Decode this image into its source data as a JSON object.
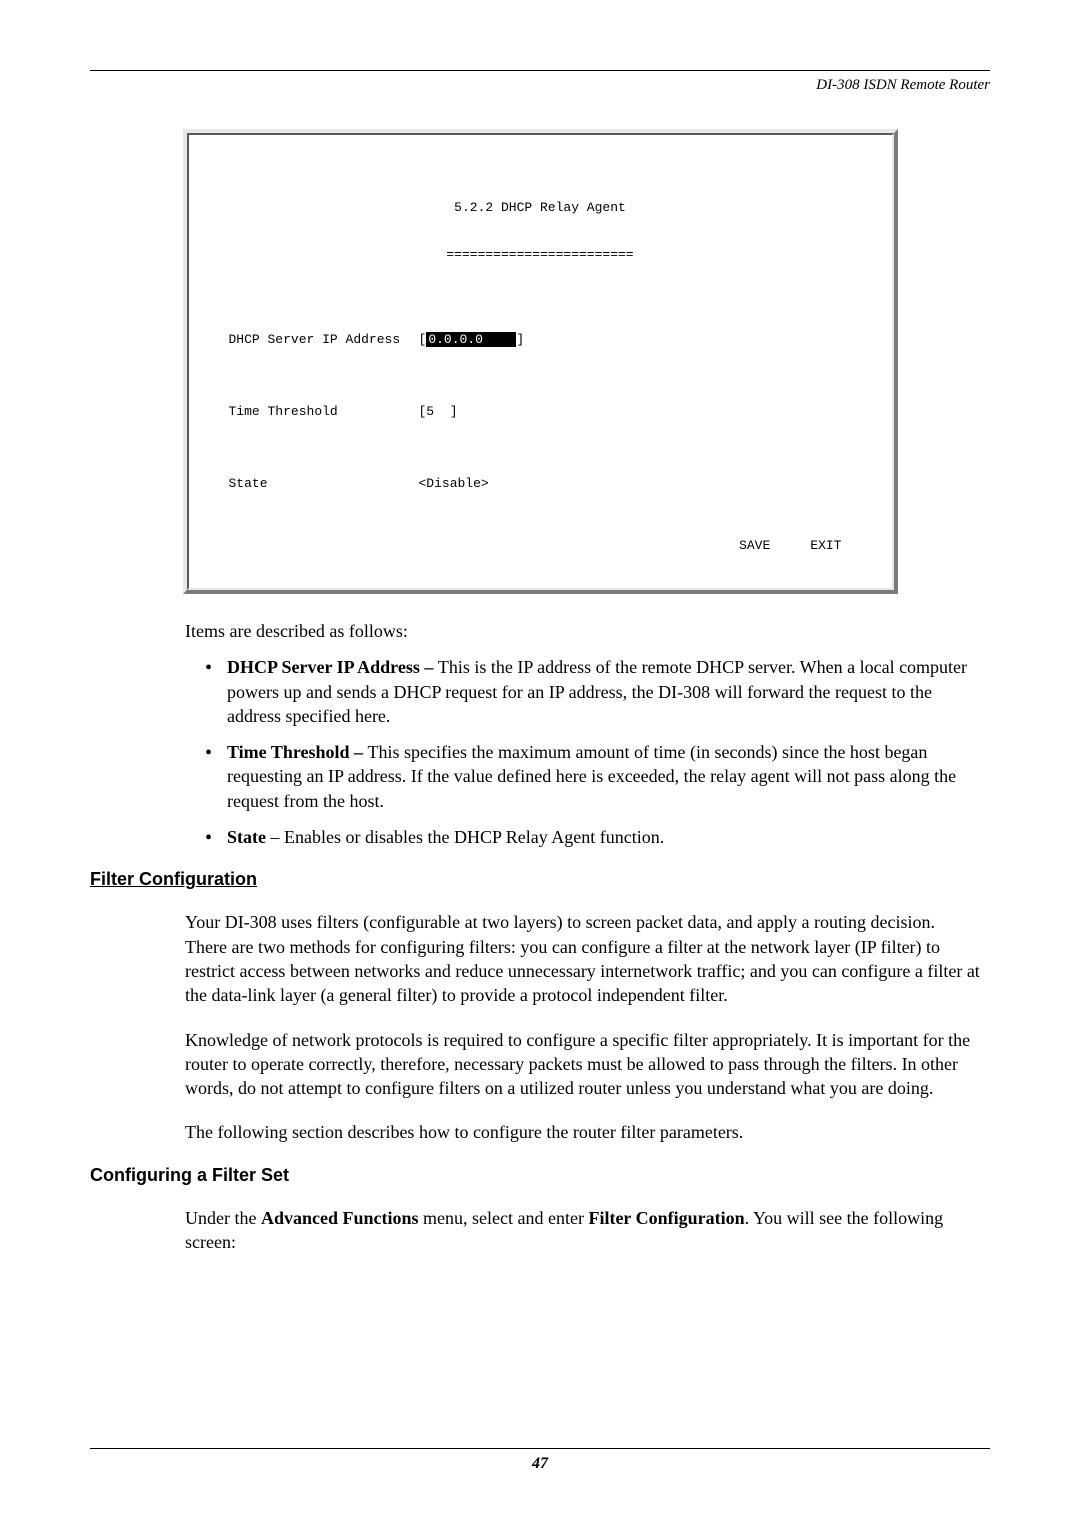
{
  "header": {
    "product": "DI-308 ISDN Remote Router"
  },
  "terminal": {
    "title": "5.2.2 DHCP Relay Agent",
    "underline": "========================",
    "rows": {
      "ip_label": "DHCP Server IP Address",
      "ip_value": "0.0.0.0",
      "time_label": "Time Threshold",
      "time_value": "[5  ]",
      "state_label": "State",
      "state_value": "<Disable>"
    },
    "save": "SAVE",
    "exit": "EXIT"
  },
  "intro_text": "Items are described as follows:",
  "items": {
    "dhcp": {
      "label": "DHCP Server IP Address – ",
      "text": "This is the IP address of the remote DHCP server. When a local computer powers up and sends a DHCP request for an IP address, the DI-308 will forward the request to the address specified here."
    },
    "time": {
      "label": "Time Threshold – ",
      "text": "This specifies the maximum amount of time (in seconds) since the host began requesting an IP address. If the value defined here is exceeded, the relay agent will not pass along the request from the host."
    },
    "state": {
      "label": "State",
      "text": " – Enables or disables the DHCP Relay Agent function."
    }
  },
  "sections": {
    "filter_title": "Filter Configuration",
    "filter_p1": "Your DI-308 uses filters (configurable at two layers) to screen packet data, and apply a routing decision. There are two methods for configuring filters: you can configure a filter at the network layer (IP filter) to restrict access between networks and reduce unnecessary internetwork traffic; and you can configure a filter at the data-link layer (a general filter) to provide a protocol independent filter.",
    "filter_p2": "Knowledge of network protocols is required to configure a specific filter appropriately. It is important for the router to operate correctly, therefore, necessary packets must be allowed to pass through the filters. In other words, do not attempt to configure filters on a utilized router unless you understand what you are doing.",
    "filter_p3": "The following section describes how to configure the router filter parameters.",
    "config_title": "Configuring a Filter Set",
    "config_p1_a": "Under the ",
    "config_p1_b": "Advanced Functions",
    "config_p1_c": " menu, select and enter ",
    "config_p1_d": "Filter Configuration",
    "config_p1_e": ". You will see the following screen:"
  },
  "page_number": "47"
}
